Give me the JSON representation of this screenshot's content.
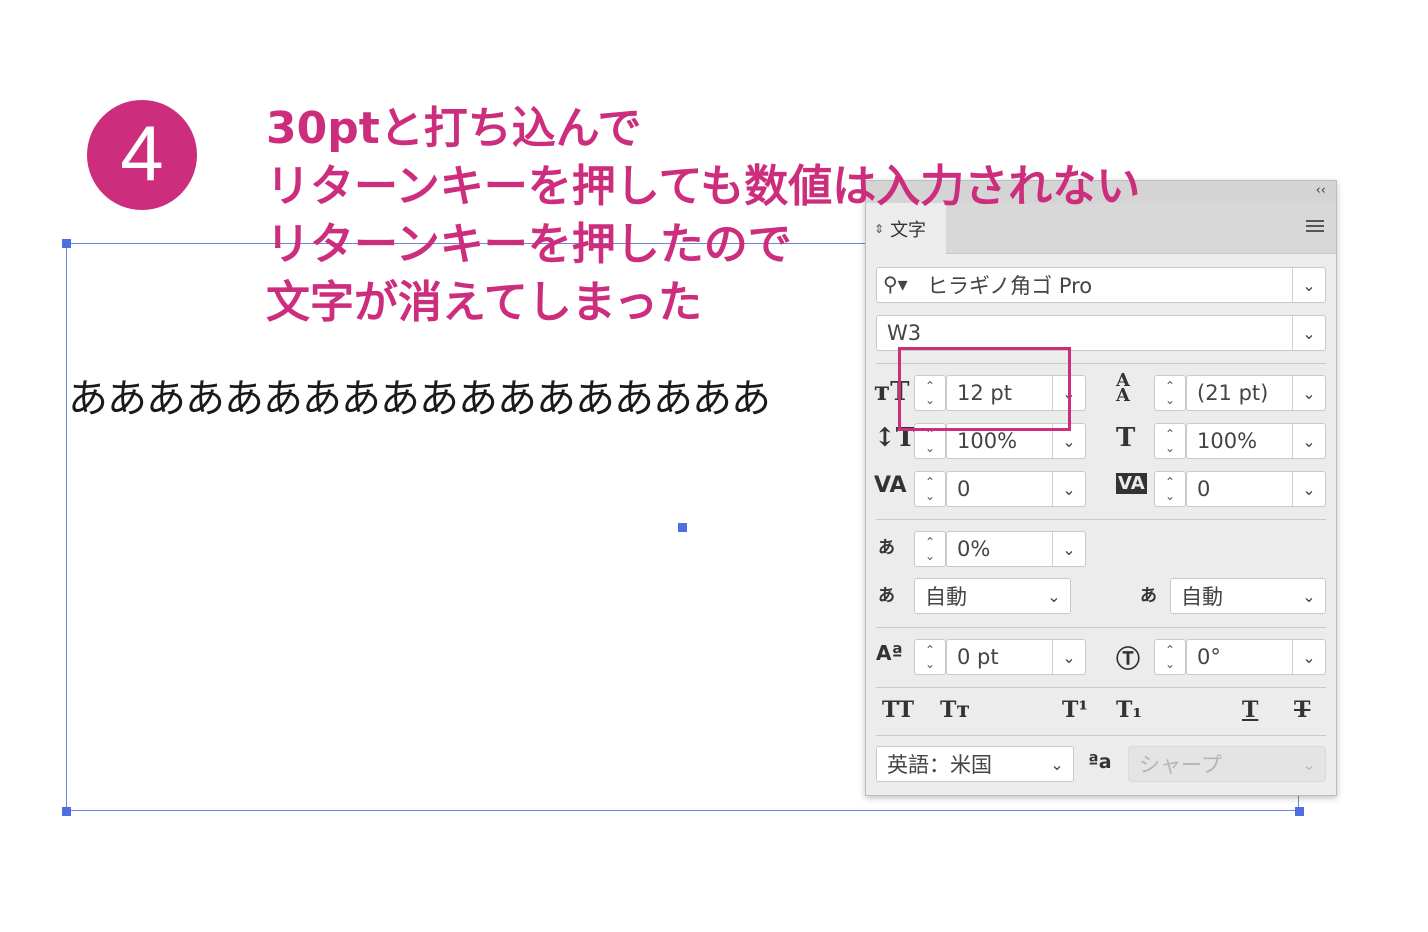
{
  "step": {
    "number": "4"
  },
  "annotation": {
    "lines": [
      "30ptと打ち込んで",
      "リターンキーを押しても数値は入力されない",
      "リターンキーを押したので",
      "文字が消えてしまった"
    ]
  },
  "text_frame": {
    "content": "ああああああああああああああああああ"
  },
  "panel": {
    "collapse_label": "‹‹",
    "tab_label": "文字",
    "font_family": {
      "value": "ヒラギノ角ゴ Pro"
    },
    "font_style": {
      "value": "W3"
    },
    "font_size": {
      "value": "12 pt"
    },
    "leading": {
      "value": "(21 pt)"
    },
    "vertical_scale": {
      "value": "100%"
    },
    "horizontal_scale": {
      "value": "100%"
    },
    "kerning": {
      "value": "0"
    },
    "tracking": {
      "value": "0"
    },
    "tsume": {
      "value": "0%"
    },
    "aki_before": {
      "value": "自動"
    },
    "aki_after": {
      "value": "自動"
    },
    "baseline_shift": {
      "value": "0 pt"
    },
    "rotation": {
      "value": "0°"
    },
    "style_buttons": [
      "TT",
      "Tт",
      "T¹",
      "T₁",
      "T",
      "T"
    ],
    "language": {
      "value": "英語：米国"
    },
    "antialias": {
      "value": "シャープ",
      "disabled": true
    }
  },
  "colors": {
    "accent": "#cc2d7d",
    "frame": "#6b86e0"
  }
}
